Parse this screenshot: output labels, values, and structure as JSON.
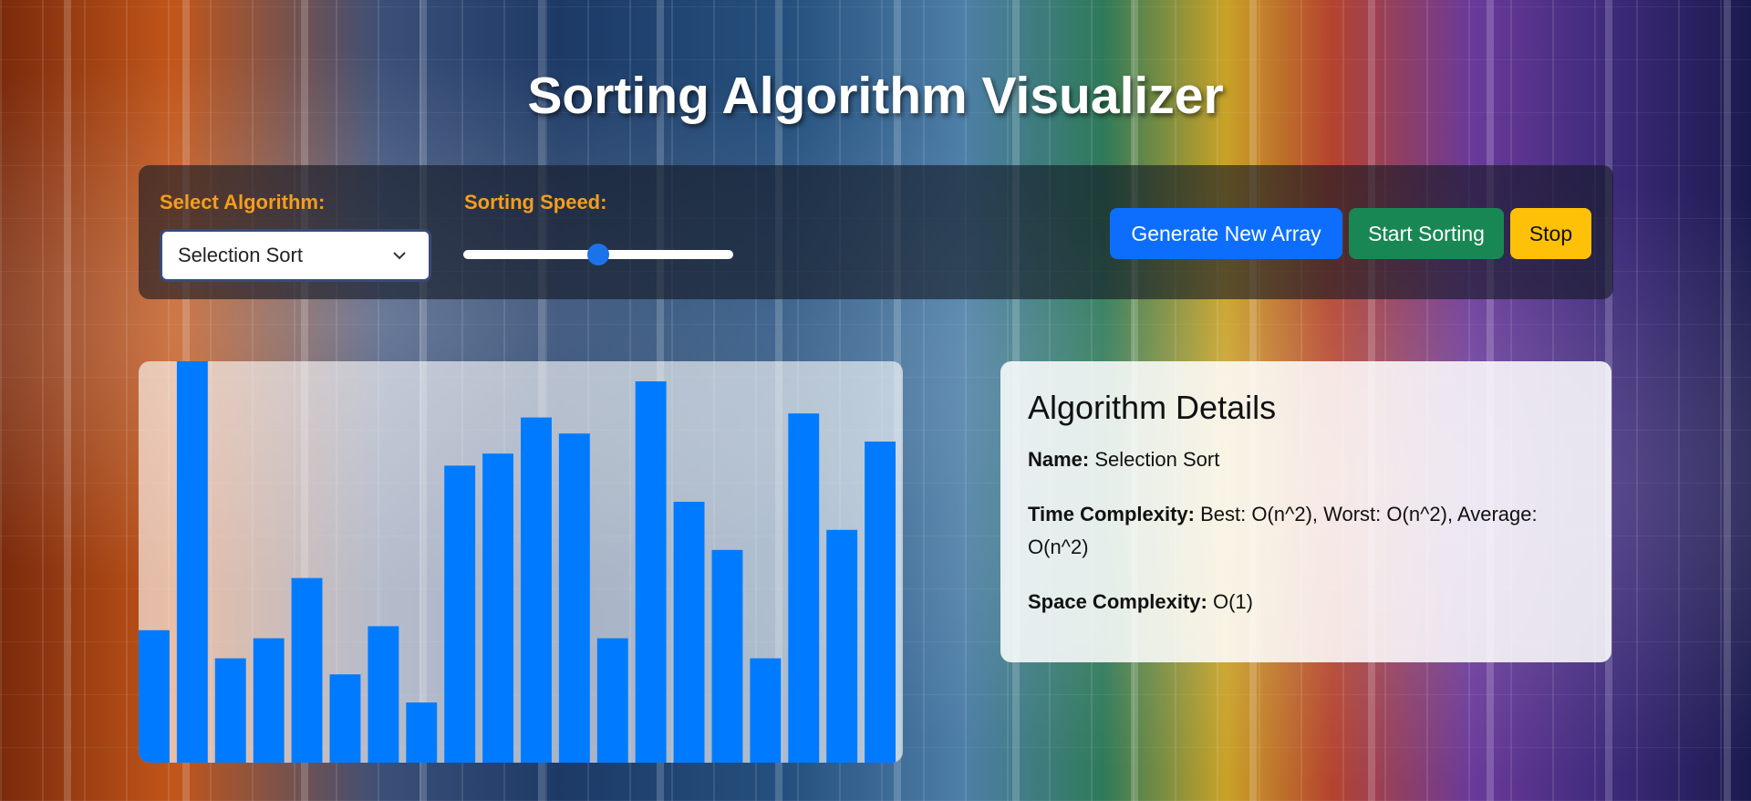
{
  "page": {
    "title": "Sorting Algorithm Visualizer"
  },
  "controls": {
    "algorithm_label": "Select Algorithm:",
    "algorithm_selected": "Selection Sort",
    "speed_label": "Sorting Speed:",
    "speed_value": 0.5,
    "generate_label": "Generate New Array",
    "start_label": "Start Sorting",
    "stop_label": "Stop"
  },
  "colors": {
    "accent": "#f59d1c",
    "bar": "#007bff",
    "generate": "#0d6efd",
    "start": "#198754",
    "stop": "#ffc107"
  },
  "details": {
    "heading": "Algorithm Details",
    "name_label": "Name:",
    "name_value": "Selection Sort",
    "time_label": "Time Complexity:",
    "time_value": "Best: O(n^2), Worst: O(n^2), Average: O(n^2)",
    "space_label": "Space Complexity:",
    "space_value": "O(1)"
  },
  "chart_data": {
    "type": "bar",
    "values": [
      33,
      100,
      26,
      31,
      46,
      22,
      34,
      15,
      74,
      77,
      86,
      82,
      31,
      95,
      65,
      53,
      26,
      87,
      58,
      80
    ],
    "ylim": [
      0,
      100
    ]
  }
}
